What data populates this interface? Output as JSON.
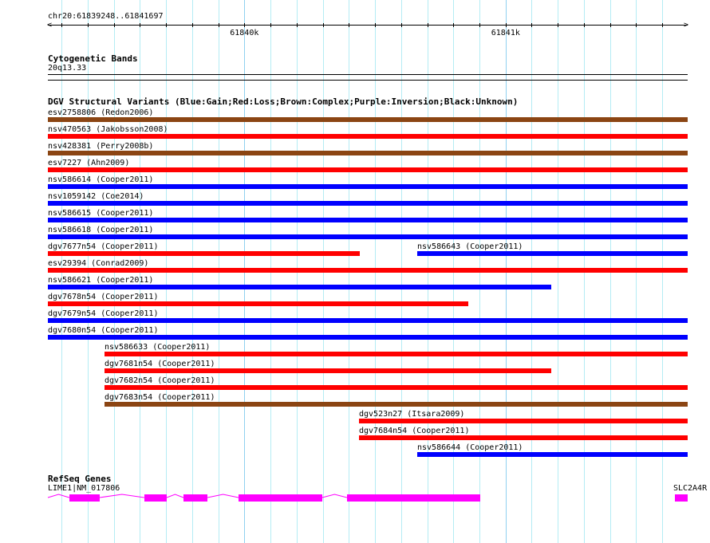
{
  "ruler": {
    "label": "chr20:61839248..61841697",
    "start": 61839248,
    "end": 61841697,
    "major_ticks": [
      {
        "pos": 61840000,
        "label": "61840k"
      },
      {
        "pos": 61841000,
        "label": "61841k"
      }
    ],
    "minor_tick_step": 100
  },
  "cytoband": {
    "title": "Cytogenetic Bands",
    "band": "20q13.33"
  },
  "dgv": {
    "title": "DGV Structural Variants (Blue:Gain;Red:Loss;Brown:Complex;Purple:Inversion;Black:Unknown)",
    "colors": {
      "gain": "#0000ff",
      "loss": "#ff0000",
      "complex": "#8b4513"
    },
    "rows": [
      [
        {
          "label": "esv2758806 (Redon2006)",
          "type": "complex",
          "start": 61839248,
          "end": 61841697
        }
      ],
      [
        {
          "label": "nsv470563 (Jakobsson2008)",
          "type": "loss",
          "start": 61839248,
          "end": 61841697
        }
      ],
      [
        {
          "label": "nsv428381 (Perry2008b)",
          "type": "complex",
          "start": 61839248,
          "end": 61841697
        }
      ],
      [
        {
          "label": "esv7227 (Ahn2009)",
          "type": "loss",
          "start": 61839248,
          "end": 61841697
        }
      ],
      [
        {
          "label": "nsv586614 (Cooper2011)",
          "type": "gain",
          "start": 61839248,
          "end": 61841697
        }
      ],
      [
        {
          "label": "nsv1059142 (Coe2014)",
          "type": "gain",
          "start": 61839248,
          "end": 61841697
        }
      ],
      [
        {
          "label": "nsv586615 (Cooper2011)",
          "type": "gain",
          "start": 61839248,
          "end": 61841697
        }
      ],
      [
        {
          "label": "nsv586618 (Cooper2011)",
          "type": "gain",
          "start": 61839248,
          "end": 61841697
        }
      ],
      [
        {
          "label": "dgv7677n54 (Cooper2011)",
          "type": "loss",
          "start": 61839248,
          "end": 61840442
        },
        {
          "label": "nsv586643 (Cooper2011)",
          "type": "gain",
          "start": 61840662,
          "end": 61841697
        }
      ],
      [
        {
          "label": "esv29394 (Conrad2009)",
          "type": "loss",
          "start": 61839248,
          "end": 61841697
        }
      ],
      [
        {
          "label": "nsv586621 (Cooper2011)",
          "type": "gain",
          "start": 61839248,
          "end": 61841175
        }
      ],
      [
        {
          "label": "dgv7678n54 (Cooper2011)",
          "type": "loss",
          "start": 61839248,
          "end": 61840857
        }
      ],
      [
        {
          "label": "dgv7679n54 (Cooper2011)",
          "type": "gain",
          "start": 61839248,
          "end": 61841697
        }
      ],
      [
        {
          "label": "dgv7680n54 (Cooper2011)",
          "type": "gain",
          "start": 61839248,
          "end": 61841697
        }
      ],
      [
        {
          "label": "nsv586633 (Cooper2011)",
          "type": "loss",
          "start": 61839465,
          "end": 61841697
        }
      ],
      [
        {
          "label": "dgv7681n54 (Cooper2011)",
          "type": "loss",
          "start": 61839465,
          "end": 61841175
        }
      ],
      [
        {
          "label": "dgv7682n54 (Cooper2011)",
          "type": "loss",
          "start": 61839465,
          "end": 61841697
        }
      ],
      [
        {
          "label": "dgv7683n54 (Cooper2011)",
          "type": "complex",
          "start": 61839465,
          "end": 61841697
        }
      ],
      [
        {
          "label": "dgv523n27 (Itsara2009)",
          "type": "loss",
          "start": 61840439,
          "end": 61841697
        }
      ],
      [
        {
          "label": "dgv7684n54 (Cooper2011)",
          "type": "loss",
          "start": 61840439,
          "end": 61841697
        }
      ],
      [
        {
          "label": "nsv586644 (Cooper2011)",
          "type": "gain",
          "start": 61840662,
          "end": 61841697
        }
      ]
    ]
  },
  "refseq": {
    "title": "RefSeq Genes",
    "color": "#ff00ff",
    "genes": [
      {
        "label": "LIME1|NM_017806",
        "start": 61839248,
        "end": 61840903,
        "exons": [
          [
            61839330,
            61839446
          ],
          [
            61839617,
            61839703
          ],
          [
            61839767,
            61839859
          ],
          [
            61839978,
            61840298
          ],
          [
            61840393,
            61840903
          ]
        ]
      },
      {
        "label": "SLC2A4R",
        "start": 61841648,
        "end": 61841697,
        "exons": [
          [
            61841648,
            61841697
          ]
        ]
      }
    ]
  }
}
